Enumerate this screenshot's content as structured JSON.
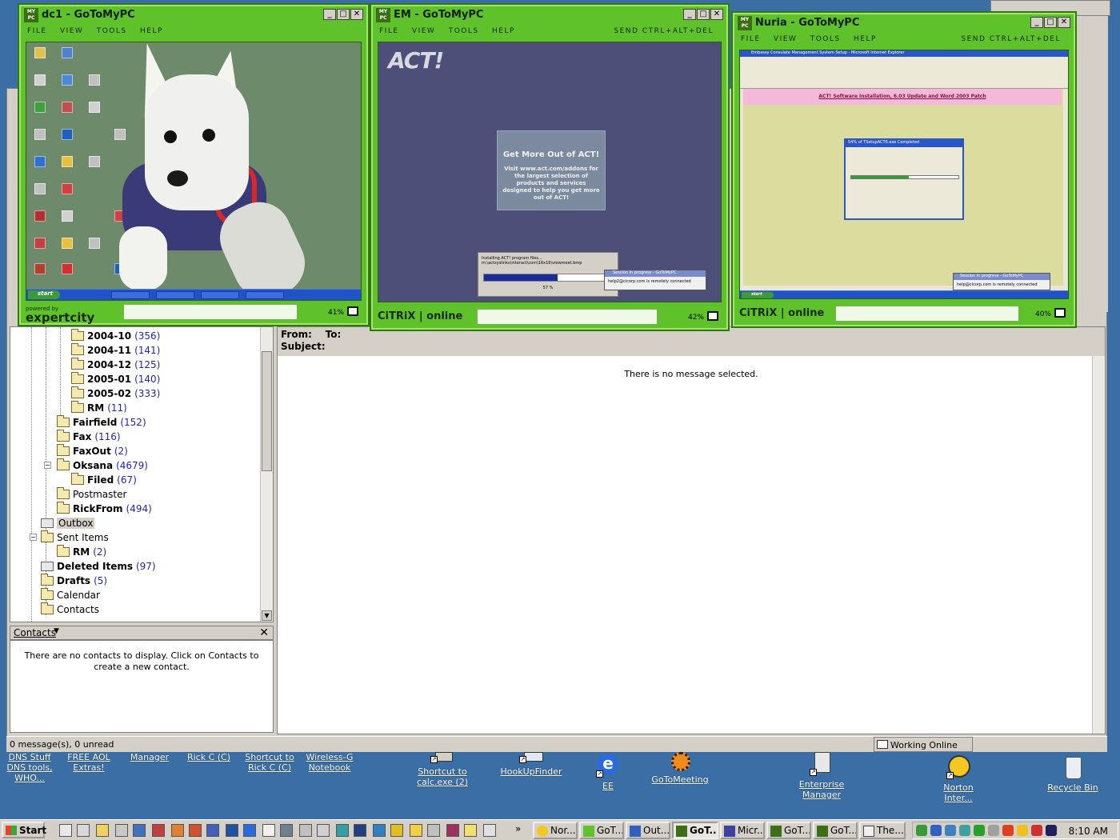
{
  "colors": {
    "desktop": "#3a6ea5",
    "g2_green": "#5fc22a",
    "count_blue": "#1f1fcc"
  },
  "outlook": {
    "folders": [
      {
        "name": "2004-10",
        "count": "(356)",
        "bold": true
      },
      {
        "name": "2004-11",
        "count": "(141)",
        "bold": true
      },
      {
        "name": "2004-12",
        "count": "(125)",
        "bold": true
      },
      {
        "name": "2005-01",
        "count": "(140)",
        "bold": true
      },
      {
        "name": "2005-02",
        "count": "(333)",
        "bold": true
      },
      {
        "name": "RM",
        "count": "(11)",
        "bold": true
      },
      {
        "name": "Fairfield",
        "count": "(152)",
        "bold": true
      },
      {
        "name": "Fax",
        "count": "(116)",
        "bold": true
      },
      {
        "name": "FaxOut",
        "count": "(2)",
        "bold": true
      },
      {
        "name": "Oksana",
        "count": "(4679)",
        "bold": true
      },
      {
        "name": "Filed",
        "count": "(67)",
        "bold": true
      },
      {
        "name": "Postmaster",
        "count": "",
        "bold": false
      },
      {
        "name": "RickFrom",
        "count": "(494)",
        "bold": true
      },
      {
        "name": "Outbox",
        "count": "",
        "bold": false
      },
      {
        "name": "Sent Items",
        "count": "",
        "bold": false
      },
      {
        "name": "RM",
        "count": "(2)",
        "bold": true
      },
      {
        "name": "Deleted Items",
        "count": "(97)",
        "bold": true
      },
      {
        "name": "Drafts",
        "count": "(5)",
        "bold": true
      },
      {
        "name": "Calendar",
        "count": "",
        "bold": false
      },
      {
        "name": "Contacts",
        "count": "",
        "bold": false
      }
    ],
    "contacts_title": "Contacts",
    "contacts_empty": "There are no contacts to display. Click on Contacts to create a new contact.",
    "preview_from": "From:",
    "preview_to": "To:",
    "preview_subject": "Subject:",
    "preview_empty": "There is no message selected.",
    "status_left": "0 message(s), 0 unread",
    "status_right": "Working Online"
  },
  "windows": {
    "dc1": {
      "title": "dc1 - GoToMyPC",
      "brand_top": "powered by",
      "brand": "expertcity",
      "zoom": "41%"
    },
    "em": {
      "title": "EM - GoToMyPC",
      "brand": "CiTRiX | online",
      "zoom": "42%",
      "send_cad": "SEND CTRL+ALT+DEL",
      "act_logo": "ACT!",
      "splash_title": "Get More Out of ACT!",
      "splash_text": "Visit www.act.com/addons for the largest selection of products and services designed to help you get more out of ACT!",
      "progress_text": "Installing ACT! program files...",
      "progress_path": "m:\\actsyslinks\\interact\\com\\16x16\\viewmeet.bmp",
      "progress_pct": "57 %",
      "progress_value": 0.57,
      "popup_title": "Session in progress - GoToMyPC",
      "popup_text": "help2@cicorp.com is remotely connected"
    },
    "nuria": {
      "title": "Nuria - GoToMyPC",
      "brand": "CiTRiX | online",
      "zoom": "40%",
      "send_cad": "SEND CTRL+ALT+DEL",
      "ie_title": "Embassy Consulate Management System Setup - Microsoft Internet Explorer",
      "page_heading": "ACT! Software Installation, 6.03 Update and Word 2003 Patch",
      "dl_title": "54% of TSetupACT6.exe Completed",
      "dl_value": 0.54,
      "popup_title": "Session in progress - GoToMyPC",
      "popup_text": "help@cicorp.com is remotely connected"
    },
    "menu": [
      "FILE",
      "VIEW",
      "TOOLS",
      "HELP"
    ]
  },
  "desktop_icons": [
    {
      "label": "DNS Stuff DNS tools, WHO..."
    },
    {
      "label": "FREE AOL Extras!"
    },
    {
      "label": "Manager"
    },
    {
      "label": "Rick C (C)"
    },
    {
      "label": "Shortcut to Rick C (C)"
    },
    {
      "label": "Wireless-G Notebook"
    },
    {
      "label": "Shortcut to calc.exe (2)"
    },
    {
      "label": "HookUpFinder"
    },
    {
      "label": "EE"
    },
    {
      "label": "GoToMeeting"
    },
    {
      "label": "Enterprise Manager"
    },
    {
      "label": "Norton Inter..."
    },
    {
      "label": "Recycle Bin"
    }
  ],
  "taskbar": {
    "start": "Start",
    "buttons": [
      "Nor...",
      "GoT...",
      "Out...",
      "GoT...",
      "Micr...",
      "GoT...",
      "GoT...",
      "The..."
    ],
    "clock": "8:10 AM"
  }
}
